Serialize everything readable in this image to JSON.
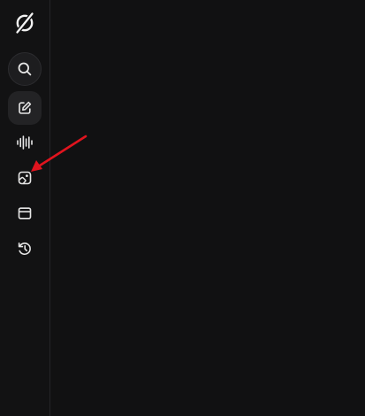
{
  "sidebar": {
    "logo": {
      "icon": "logo-icon"
    },
    "items": [
      {
        "id": "search",
        "icon": "search-icon"
      },
      {
        "id": "compose",
        "icon": "edit-icon",
        "selected": true
      },
      {
        "id": "voice",
        "icon": "waveform-icon"
      },
      {
        "id": "imagine",
        "icon": "image-icon"
      },
      {
        "id": "projects",
        "icon": "folder-icon"
      },
      {
        "id": "history",
        "icon": "history-icon"
      }
    ]
  },
  "annotation": {
    "color": "#e0141e",
    "points_to": "imagine"
  },
  "colors": {
    "background": "#111112",
    "sidebar": "#121213",
    "icon": "#e6e6e6",
    "active_bg": "#232325"
  }
}
